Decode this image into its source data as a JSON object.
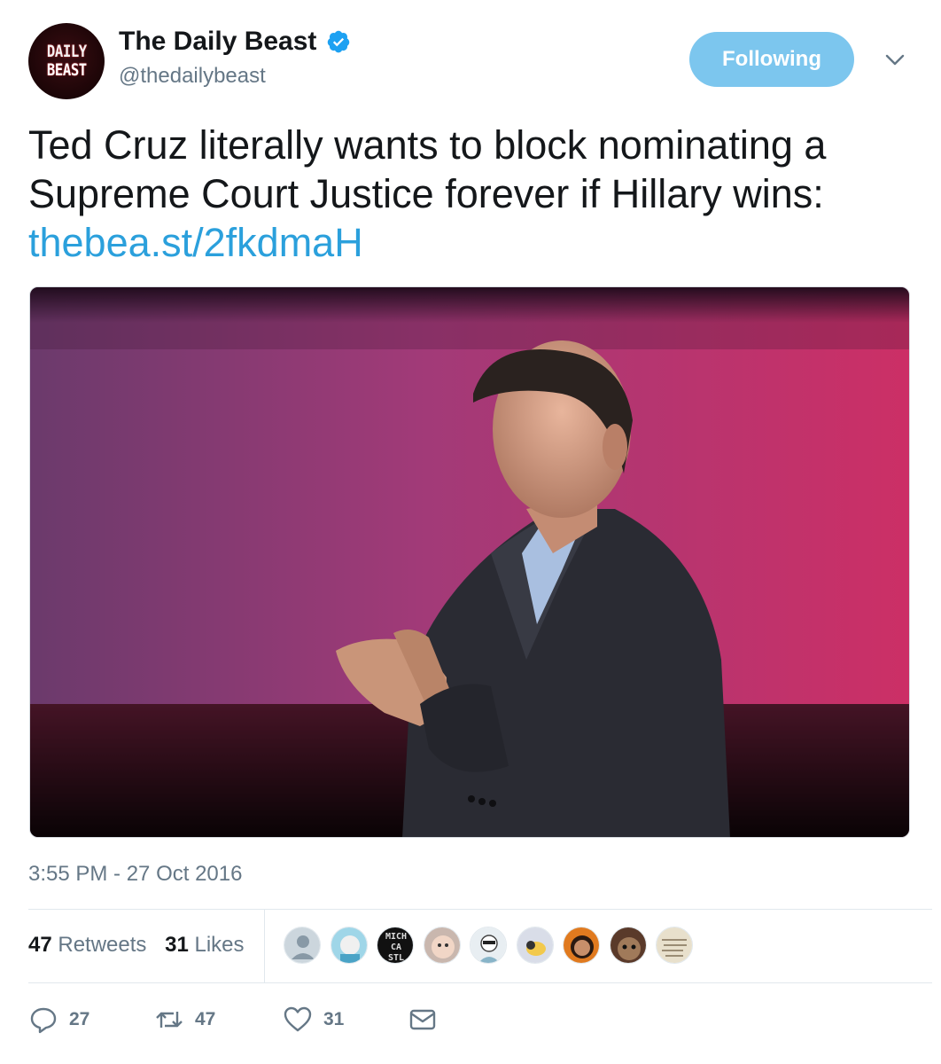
{
  "account": {
    "display_name": "The Daily Beast",
    "handle": "@thedailybeast",
    "avatar_logo_lines": [
      "DAILY",
      "BEAST"
    ],
    "verified_icon": "verified-badge-icon"
  },
  "follow_button": {
    "label": "Following",
    "color": "#7cc6ee"
  },
  "more_menu_icon": "chevron-down-icon",
  "tweet": {
    "text": "Ted Cruz literally wants to block nominating a Supreme Court Justice forever if Hillary wins:",
    "link": "thebea.st/2fkdmaH",
    "link_color": "#2ba0dc"
  },
  "media": {
    "description": "photo-of-speaker-on-pink-stage-background"
  },
  "timestamp": "3:55 PM - 27 Oct 2016",
  "stats": {
    "retweets_count": "47",
    "retweets_label": "Retweets",
    "likes_count": "31",
    "likes_label": "Likes"
  },
  "likers": [
    {
      "name": "default-avatar"
    },
    {
      "name": "cartoon-avatar"
    },
    {
      "name": "mich-ca-stl-avatar",
      "lettering": [
        "MICH",
        "CA",
        "STL"
      ]
    },
    {
      "name": "baby-avatar"
    },
    {
      "name": "sketch-avatar"
    },
    {
      "name": "bird-avatar"
    },
    {
      "name": "woman-avatar"
    },
    {
      "name": "dog-avatar"
    },
    {
      "name": "handwriting-avatar"
    }
  ],
  "actions": {
    "reply": {
      "icon": "reply-icon",
      "count": "27"
    },
    "retweet": {
      "icon": "retweet-icon",
      "count": "47"
    },
    "like": {
      "icon": "heart-icon",
      "count": "31"
    },
    "dm": {
      "icon": "envelope-icon"
    }
  }
}
